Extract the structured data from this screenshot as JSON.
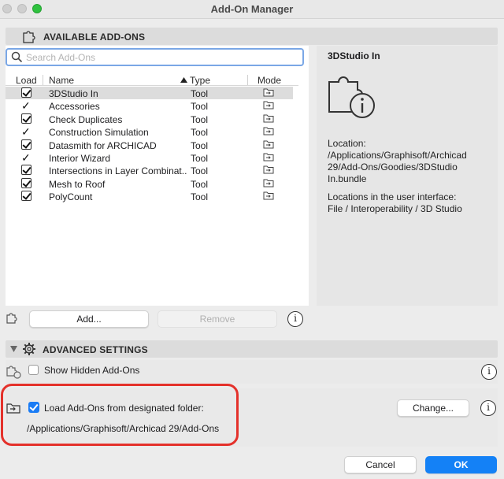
{
  "window": {
    "title": "Add-On Manager"
  },
  "available": {
    "header": "AVAILABLE ADD-ONS",
    "search_placeholder": "Search Add-Ons",
    "columns": {
      "load": "Load",
      "name": "Name",
      "type": "Type",
      "mode": "Mode"
    },
    "rows": [
      {
        "name": "3DStudio In",
        "type": "Tool",
        "load": "checkbox"
      },
      {
        "name": "Accessories",
        "type": "Tool",
        "load": "tick"
      },
      {
        "name": "Check Duplicates",
        "type": "Tool",
        "load": "checkbox"
      },
      {
        "name": "Construction Simulation",
        "type": "Tool",
        "load": "tick"
      },
      {
        "name": "Datasmith for ARCHICAD",
        "type": "Tool",
        "load": "checkbox"
      },
      {
        "name": "Interior Wizard",
        "type": "Tool",
        "load": "tick"
      },
      {
        "name": "Intersections in Layer Combinat...",
        "type": "Tool",
        "load": "checkbox"
      },
      {
        "name": "Mesh to Roof",
        "type": "Tool",
        "load": "checkbox"
      },
      {
        "name": "PolyCount",
        "type": "Tool",
        "load": "checkbox"
      }
    ],
    "add_label": "Add...",
    "remove_label": "Remove"
  },
  "details": {
    "title": "3DStudio In",
    "location_label": "Location:",
    "location_path": "/Applications/Graphisoft/Archicad 29/Add-Ons/Goodies/3DStudio In.bundle",
    "ui_label": "Locations in the user interface:",
    "ui_path": "File / Interoperability / 3D Studio"
  },
  "advanced": {
    "header": "ADVANCED SETTINGS",
    "show_hidden_label": "Show Hidden Add-Ons",
    "load_designated_label": "Load Add-Ons from designated folder:",
    "folder_path": "/Applications/Graphisoft/Archicad 29/Add-Ons",
    "change_label": "Change..."
  },
  "footer": {
    "cancel_label": "Cancel",
    "ok_label": "OK"
  },
  "colors": {
    "accent": "#1481f6",
    "highlight_box": "#e4312b",
    "green_light": "#2fc23f"
  },
  "icons": [
    "puzzle-icon",
    "search-icon",
    "sort-ascending-icon",
    "folder-mode-icon",
    "puzzle-info-icon",
    "info-icon",
    "gear-icon",
    "disclosure-triangle-icon",
    "puzzle-eye-icon",
    "folder-arrow-icon"
  ]
}
